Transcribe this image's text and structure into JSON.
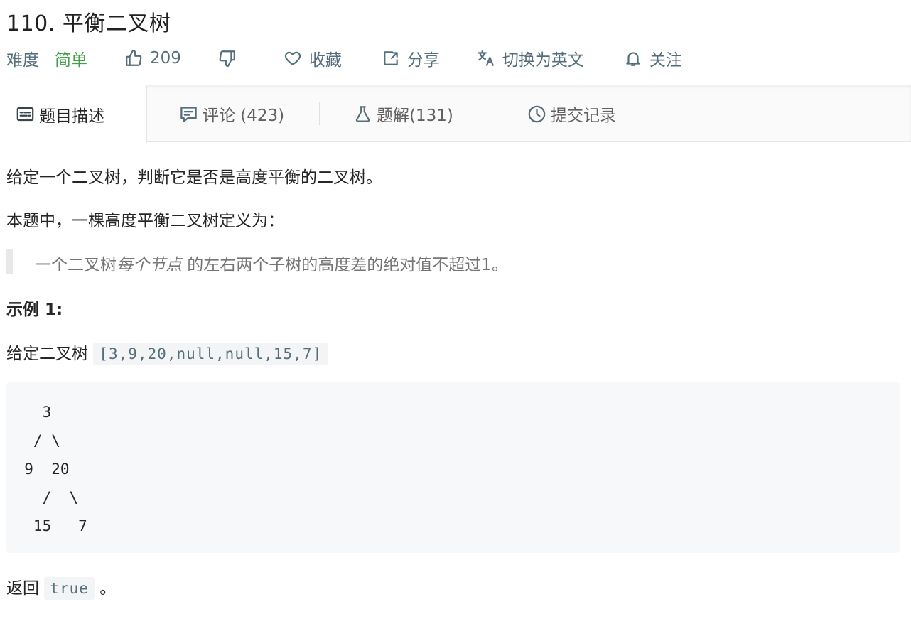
{
  "problem": {
    "title": "110. 平衡二叉树",
    "difficulty_label": "难度",
    "difficulty_value": "简单",
    "likes": "209",
    "favorite_label": "收藏",
    "share_label": "分享",
    "switch_lang_label": "切换为英文",
    "follow_label": "关注"
  },
  "tabs": [
    {
      "label": "题目描述",
      "icon": "description-icon"
    },
    {
      "label": "评论 (423)",
      "icon": "comment-icon"
    },
    {
      "label": "题解(131)",
      "icon": "flask-icon"
    },
    {
      "label": "提交记录",
      "icon": "clock-icon"
    }
  ],
  "description": {
    "intro": "给定一个二叉树，判断它是否是高度平衡的二叉树。",
    "definition_intro": "本题中，一棵高度平衡二叉树定义为：",
    "quote_prefix": "一个二叉树",
    "quote_emph": "每个节点",
    "quote_suffix": " 的左右两个子树的高度差的绝对值不超过1。",
    "example_title": "示例 1:",
    "given_label": "给定二叉树 ",
    "given_value": "[3,9,20,null,null,15,7]",
    "tree_ascii": "    3\n   / \\\n  9  20\n    /  \\\n   15   7",
    "return_label": "返回 ",
    "return_value": "true",
    "return_suffix": " 。"
  },
  "colors": {
    "easy": "#43a047",
    "icon": "#546e7a",
    "code_bg": "#f7f8fa"
  }
}
